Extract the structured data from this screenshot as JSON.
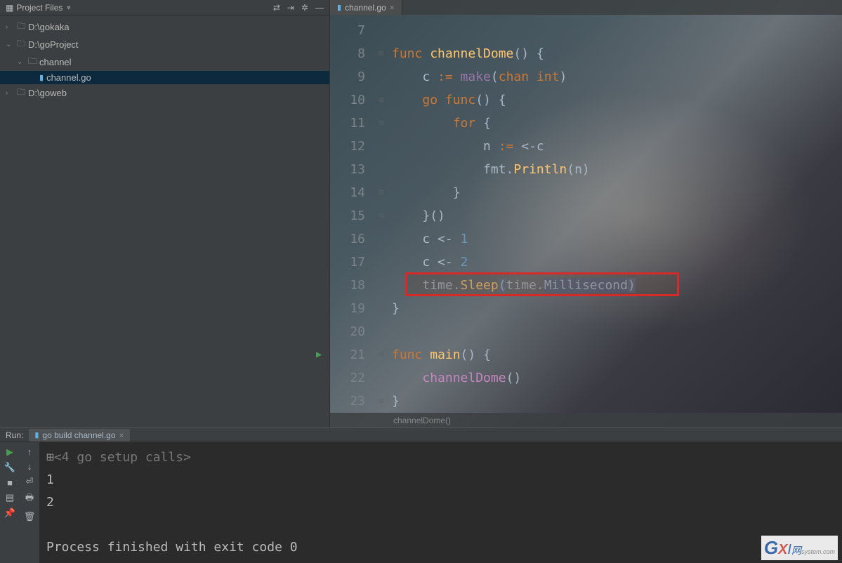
{
  "sidebar": {
    "title": "Project Files",
    "items": [
      {
        "label": "D:\\gokaka",
        "type": "folder",
        "expanded": false,
        "indent": 0
      },
      {
        "label": "D:\\goProject",
        "type": "folder",
        "expanded": true,
        "indent": 0
      },
      {
        "label": "channel",
        "type": "folder",
        "expanded": true,
        "indent": 1
      },
      {
        "label": "channel.go",
        "type": "file",
        "selected": true,
        "indent": 2
      },
      {
        "label": "D:\\goweb",
        "type": "folder",
        "expanded": false,
        "indent": 0
      }
    ]
  },
  "editor": {
    "tab": {
      "label": "channel.go"
    },
    "breadcrumb": "channelDome()",
    "lines": [
      {
        "num": 7,
        "tokens": []
      },
      {
        "num": 8,
        "tokens": [
          [
            "kw",
            "func "
          ],
          [
            "func",
            "channelDome"
          ],
          [
            "punc",
            "() {"
          ]
        ]
      },
      {
        "num": 9,
        "tokens": [
          [
            "ident",
            "    c "
          ],
          [
            "assign",
            ":= "
          ],
          [
            "builtin",
            "make"
          ],
          [
            "punc",
            "("
          ],
          [
            "kw",
            "chan "
          ],
          [
            "kw",
            "int"
          ],
          [
            "punc",
            ")"
          ]
        ]
      },
      {
        "num": 10,
        "tokens": [
          [
            "ident",
            "    "
          ],
          [
            "kw",
            "go "
          ],
          [
            "kw",
            "func"
          ],
          [
            "punc",
            "() {"
          ]
        ]
      },
      {
        "num": 11,
        "tokens": [
          [
            "ident",
            "        "
          ],
          [
            "kw",
            "for "
          ],
          [
            "punc",
            "{"
          ]
        ]
      },
      {
        "num": 12,
        "tokens": [
          [
            "ident",
            "            n "
          ],
          [
            "assign",
            ":= "
          ],
          [
            "op",
            "<-"
          ],
          [
            "ident",
            "c"
          ]
        ]
      },
      {
        "num": 13,
        "tokens": [
          [
            "ident",
            "            fmt."
          ],
          [
            "func",
            "Println"
          ],
          [
            "punc",
            "(n)"
          ]
        ]
      },
      {
        "num": 14,
        "tokens": [
          [
            "ident",
            "        "
          ],
          [
            "punc",
            "}"
          ]
        ]
      },
      {
        "num": 15,
        "tokens": [
          [
            "ident",
            "    "
          ],
          [
            "punc",
            "}()"
          ]
        ]
      },
      {
        "num": 16,
        "tokens": [
          [
            "ident",
            "    c "
          ],
          [
            "op",
            "<- "
          ],
          [
            "num",
            "1"
          ]
        ]
      },
      {
        "num": 17,
        "tokens": [
          [
            "ident",
            "    c "
          ],
          [
            "op",
            "<- "
          ],
          [
            "num",
            "2"
          ]
        ]
      },
      {
        "num": 18,
        "tokens": [
          [
            "ident",
            "    time."
          ],
          [
            "func",
            "Sleep"
          ],
          [
            "paren-hl",
            "("
          ],
          [
            "ident",
            "time."
          ],
          [
            "sel",
            "Millisecond"
          ],
          [
            "paren-hl",
            ")"
          ]
        ],
        "highlight": true
      },
      {
        "num": 19,
        "tokens": [
          [
            "punc",
            "}"
          ]
        ]
      },
      {
        "num": 20,
        "tokens": []
      },
      {
        "num": 21,
        "tokens": [
          [
            "kw",
            "func "
          ],
          [
            "func",
            "main"
          ],
          [
            "punc",
            "() {"
          ]
        ],
        "play": true
      },
      {
        "num": 22,
        "tokens": [
          [
            "ident",
            "    "
          ],
          [
            "call",
            "channelDome"
          ],
          [
            "punc",
            "()"
          ]
        ]
      },
      {
        "num": 23,
        "tokens": [
          [
            "punc",
            "}"
          ]
        ]
      }
    ]
  },
  "run": {
    "label": "Run:",
    "tab": "go build channel.go",
    "output": {
      "setup": "<4 go setup calls>",
      "line1": "1",
      "line2": "2",
      "finished": "Process finished with exit code 0"
    }
  },
  "watermark": {
    "g": "G",
    "x": "X",
    "i": "I",
    "net": "网",
    "sub": "system.com"
  }
}
